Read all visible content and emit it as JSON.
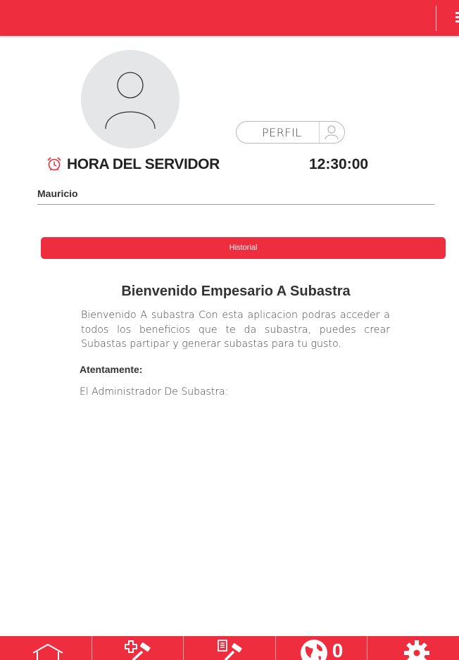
{
  "header": {
    "menu_icon": "hamburger-menu-icon"
  },
  "profile": {
    "avatar_icon": "user-placeholder-icon",
    "perfil_label": "PERFIL",
    "perfil_icon": "user-outline-icon",
    "username": "Mauricio"
  },
  "server": {
    "label": "HORA DEL SERVIDOR",
    "time": "12:30:00",
    "clock_icon": "alarm-clock-icon"
  },
  "actions": {
    "historial_label": "Historial"
  },
  "welcome": {
    "title": "Bienvenido Empesario A Subastra",
    "body": "Bienvenido A subastra Con esta aplicacion podras acceder a todos los beneficios que te da subastra, puedes crear Subastas partipar y generar subastas para tu gusto.",
    "sign_head": "Atentamente:",
    "sign_name": "El Administrador De Subastra:"
  },
  "bottom_nav": {
    "items": [
      {
        "icon": "home-icon"
      },
      {
        "icon": "add-auction-icon"
      },
      {
        "icon": "auction-list-icon"
      },
      {
        "icon": "globe-icon",
        "count": "0"
      },
      {
        "icon": "gear-icon"
      }
    ]
  },
  "colors": {
    "accent": "#ee2d3f",
    "text": "#333333",
    "avatar_bg": "#e5e6e8"
  }
}
